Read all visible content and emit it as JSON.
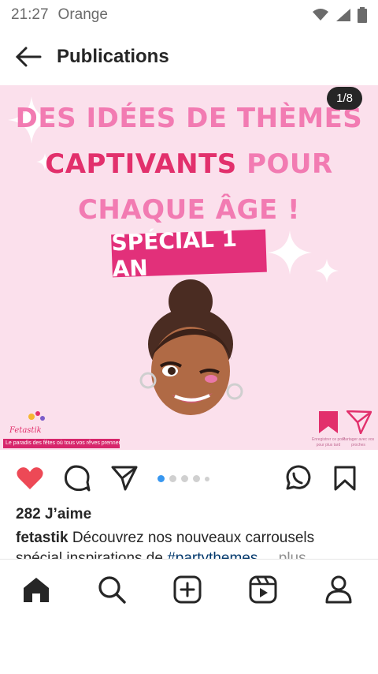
{
  "status_bar": {
    "time": "21:27",
    "carrier": "Orange",
    "icons": [
      "wifi-icon",
      "signal-icon",
      "battery-icon"
    ]
  },
  "header": {
    "title": "Publications",
    "back_icon": "arrow-left-icon"
  },
  "post": {
    "counter": "1/8",
    "slide_text": {
      "line1": "DES IDÉES DE THÈMES",
      "line2_dark": "CAPTIVANTS",
      "line2_light": "POUR",
      "line3": "CHAQUE ÂGE !",
      "tag": "SPÉCIAL 1 AN"
    },
    "brand": {
      "logo_text": "Fetastik",
      "banner": "Le paradis des fêtes où tous vos rêves prennent vie"
    },
    "side_captions": [
      "Enregistrer ce post pour plus tard",
      "Partager avec vos proches"
    ],
    "colors": {
      "background": "#fbe0ec",
      "pink_light": "#f27bb2",
      "pink_dark": "#e2306c"
    }
  },
  "actions": {
    "like_icon": "heart-filled-icon",
    "comment_icon": "comment-icon",
    "share_icon": "send-icon",
    "whatsapp_icon": "whatsapp-icon",
    "save_icon": "bookmark-icon",
    "carousel_dots": 5,
    "active_dot": 0
  },
  "likes": "282 J’aime",
  "caption": {
    "username": "fetastik",
    "text": "Découvrez nos nouveaux carrousels",
    "line2_prefix": "spécial inspirations de",
    "hashtag": "#partythemes",
    "more": "... plus"
  },
  "bottom_nav": {
    "items": [
      "home-icon",
      "search-icon",
      "create-icon",
      "reels-icon",
      "profile-icon"
    ]
  }
}
